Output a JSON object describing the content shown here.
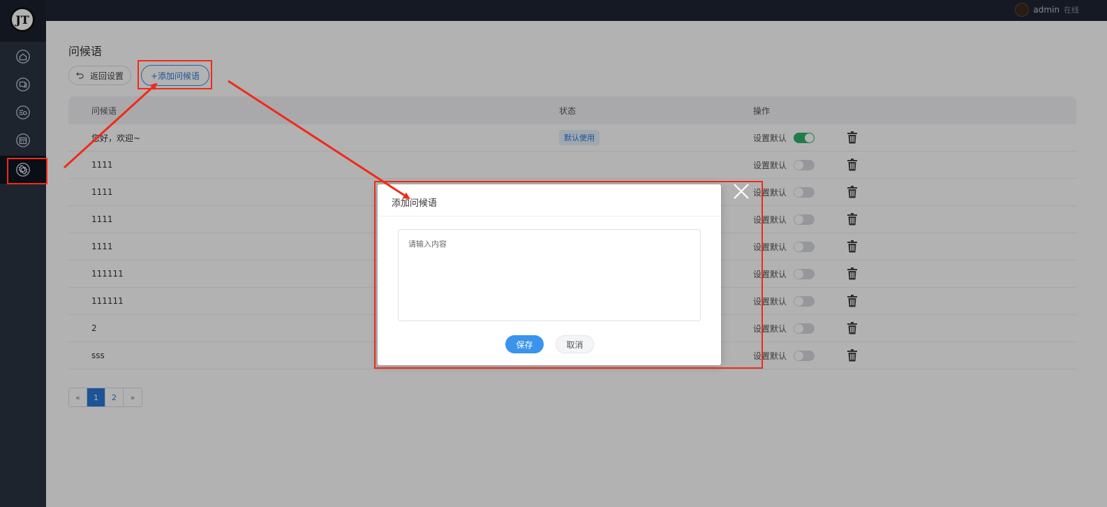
{
  "topbar": {
    "user_name": "admin",
    "user_status": "在线"
  },
  "sidebar": {
    "logo_text": "JT",
    "items": [
      {
        "icon": "home-icon"
      },
      {
        "icon": "chat-icon"
      },
      {
        "icon": "list-settings-icon"
      },
      {
        "icon": "calendar-icon"
      },
      {
        "icon": "settings-icon",
        "active": true
      }
    ]
  },
  "main": {
    "title": "问候语",
    "back_label": "返回设置",
    "add_label": "+添加问候语",
    "columns": [
      "问候语",
      "状态",
      "操作"
    ],
    "rows": [
      {
        "text": "您好，欢迎~",
        "status": "默认使用",
        "action": "设置默认",
        "default": true
      },
      {
        "text": "1111",
        "status": "",
        "action": "设置默认",
        "default": false
      },
      {
        "text": "1111",
        "status": "",
        "action": "设置默认",
        "default": false
      },
      {
        "text": "1111",
        "status": "",
        "action": "设置默认",
        "default": false
      },
      {
        "text": "1111",
        "status": "",
        "action": "设置默认",
        "default": false
      },
      {
        "text": "111111",
        "status": "",
        "action": "设置默认",
        "default": false
      },
      {
        "text": "111111",
        "status": "",
        "action": "设置默认",
        "default": false
      },
      {
        "text": "2",
        "status": "",
        "action": "设置默认",
        "default": false
      },
      {
        "text": "sss",
        "status": "",
        "action": "设置默认",
        "default": false
      }
    ],
    "pagination": {
      "prev": "«",
      "pages": [
        "1",
        "2"
      ],
      "current": "1",
      "next": "»"
    }
  },
  "dialog": {
    "title": "添加问候语",
    "placeholder": "请输入内容",
    "value": "",
    "save_label": "保存",
    "cancel_label": "取消"
  },
  "colors": {
    "accent": "#2a77d9",
    "switch_on": "#2fb36b",
    "annotation": "#f02a1a",
    "sidebar": "#2c3443"
  }
}
